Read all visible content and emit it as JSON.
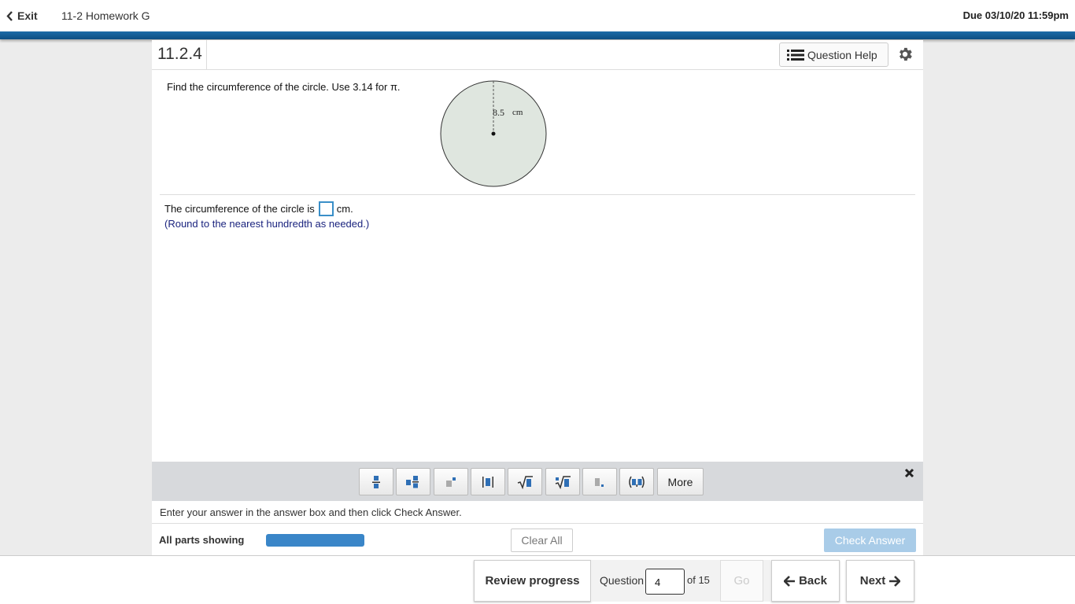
{
  "header": {
    "exit_label": "Exit",
    "homework_title": "11-2 Homework G",
    "due_text": "Due 03/10/20 11:59pm"
  },
  "question": {
    "number": "11.2.4",
    "help_label": "Question Help",
    "prompt_text": "Find the circumference of the circle. Use 3.14 for π.",
    "figure": {
      "radius_value": "8.5",
      "radius_unit": "cm"
    },
    "answer_prefix": "The circumference of the circle is",
    "answer_value": "",
    "answer_suffix": "cm.",
    "rounding_note": "(Round to the nearest hundredth as needed.)"
  },
  "palette": {
    "buttons": [
      "fraction-icon",
      "mixed-number-icon",
      "exponent-icon",
      "absolute-value-icon",
      "square-root-icon",
      "nth-root-icon",
      "decimal-icon",
      "ordered-pair-icon"
    ],
    "more_label": "More"
  },
  "footer": {
    "instructions": "Enter your answer in the answer box and then click Check Answer.",
    "parts_label": "All parts showing",
    "progress": 1.0,
    "clear_all_label": "Clear All",
    "check_answer_label": "Check Answer"
  },
  "nav": {
    "review_label": "Review progress",
    "question_label": "Question",
    "current_question": "4",
    "of_label": "of 15",
    "go_label": "Go",
    "back_label": "Back",
    "next_label": "Next"
  },
  "colors": {
    "header_blue": "#0d4f82",
    "progress_blue": "#3a86c8",
    "check_answer_disabled": "#a9cce8",
    "circle_fill": "#dfe6df",
    "note_color": "#1a237e"
  }
}
